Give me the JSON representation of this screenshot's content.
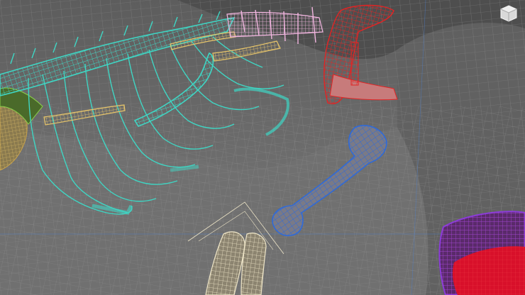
{
  "viewport": {
    "mode": "wireframe-on-shaded",
    "background_color": "#6b6b6b"
  },
  "viewcube": {
    "icon": "viewcube-icon"
  },
  "objects": [
    {
      "name": "spine-and-ribcage",
      "wire_color": "#3fd6c4"
    },
    {
      "name": "cervical-vertebrae",
      "wire_color": "#f2b6e0"
    },
    {
      "name": "skull-jaw",
      "wire_color": "#e22424"
    },
    {
      "name": "humerus",
      "wire_color": "#2f6ad8"
    },
    {
      "name": "clavicle-bones",
      "wire_color": "#e6c46a"
    },
    {
      "name": "pelvis",
      "wire_color": "#c9a24a"
    },
    {
      "name": "femur-pair",
      "wire_color": "#d8cfb0"
    },
    {
      "name": "container-bowl",
      "wire_color": "#8a3bd8",
      "fill_color": "#d8102a"
    },
    {
      "name": "ground-terrain",
      "wire_color": "#9a9a9a"
    }
  ]
}
